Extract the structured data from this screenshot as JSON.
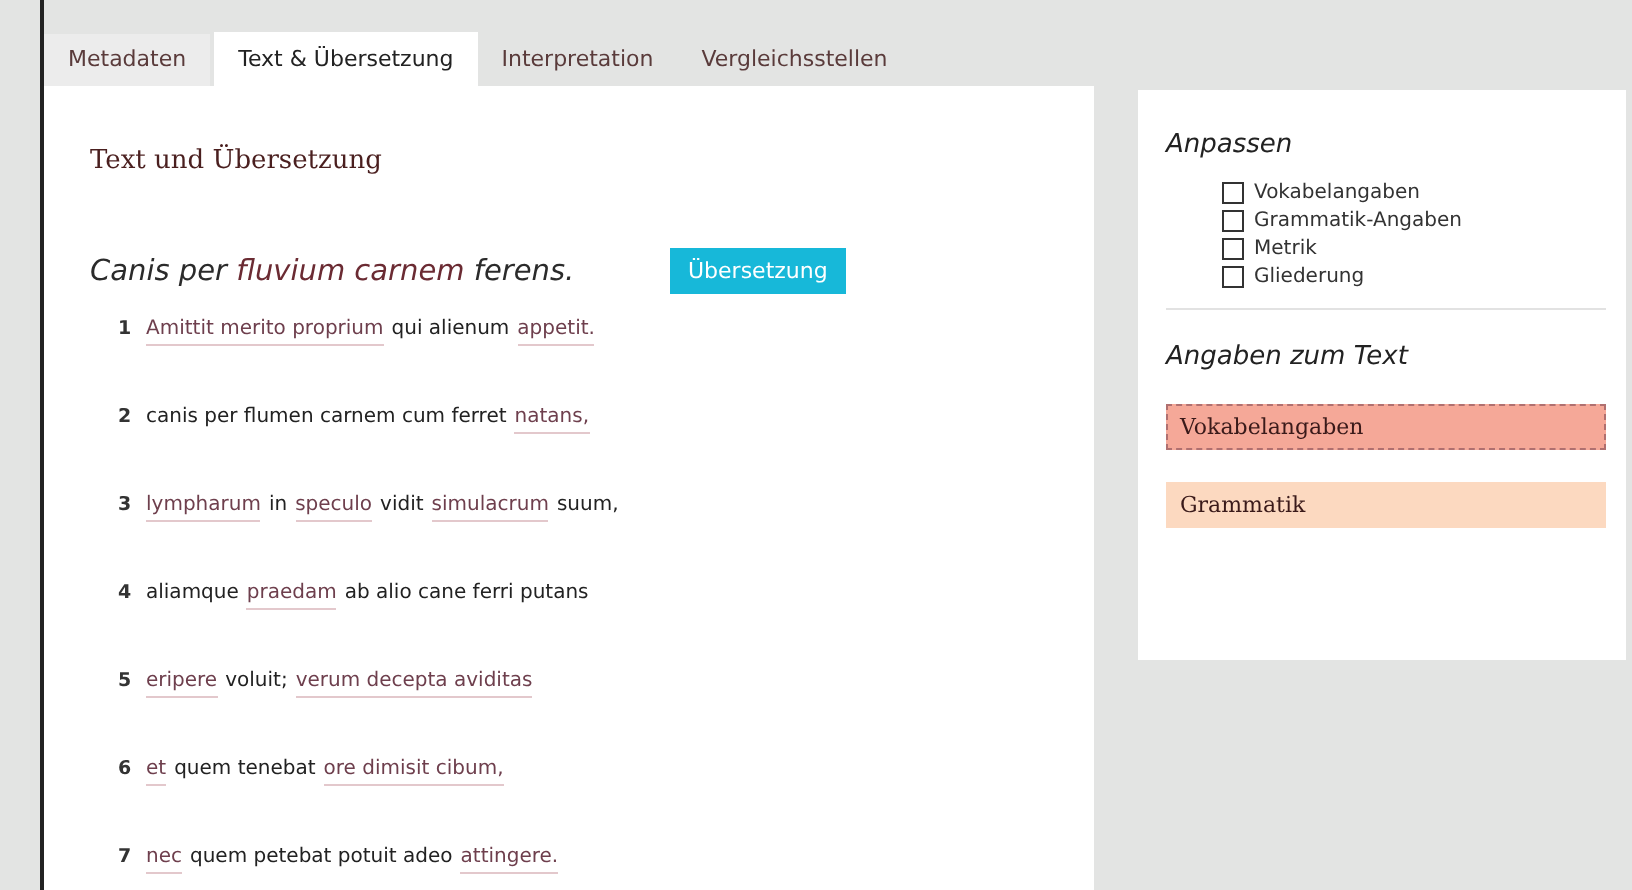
{
  "tabs": [
    {
      "label": "Metadaten",
      "selected": false
    },
    {
      "label": "Text & Übersetzung",
      "selected": true
    },
    {
      "label": "Interpretation",
      "selected": false
    },
    {
      "label": "Vergleichsstellen",
      "selected": false
    }
  ],
  "main": {
    "heading": "Text und Übersetzung",
    "poem_title": [
      {
        "text": "Canis per ",
        "highlighted": false
      },
      {
        "text": "fluvium carnem",
        "highlighted": true
      },
      {
        "text": " ferens.",
        "highlighted": false
      }
    ],
    "translate_button": "Übersetzung",
    "lines": [
      {
        "number": "1",
        "segments": [
          {
            "text": "Amittit merito proprium",
            "annotated": true
          },
          {
            "text": "qui alienum",
            "annotated": false
          },
          {
            "text": "appetit.",
            "annotated": true
          }
        ]
      },
      {
        "number": "2",
        "segments": [
          {
            "text": "canis per flumen carnem cum ferret",
            "annotated": false
          },
          {
            "text": "natans,",
            "annotated": true
          }
        ]
      },
      {
        "number": "3",
        "segments": [
          {
            "text": "lympharum",
            "annotated": true
          },
          {
            "text": "in",
            "annotated": false
          },
          {
            "text": "speculo",
            "annotated": true
          },
          {
            "text": "vidit",
            "annotated": false
          },
          {
            "text": "simulacrum",
            "annotated": true
          },
          {
            "text": "suum,",
            "annotated": false
          }
        ]
      },
      {
        "number": "4",
        "segments": [
          {
            "text": "aliamque",
            "annotated": false
          },
          {
            "text": "praedam",
            "annotated": true
          },
          {
            "text": "ab alio cane ferri putans",
            "annotated": false
          }
        ]
      },
      {
        "number": "5",
        "segments": [
          {
            "text": "eripere",
            "annotated": true
          },
          {
            "text": "voluit;",
            "annotated": false
          },
          {
            "text": "verum decepta aviditas",
            "annotated": true
          }
        ]
      },
      {
        "number": "6",
        "segments": [
          {
            "text": "et",
            "annotated": true
          },
          {
            "text": "quem tenebat",
            "annotated": false
          },
          {
            "text": "ore dimisit cibum,",
            "annotated": true
          }
        ]
      },
      {
        "number": "7",
        "segments": [
          {
            "text": "nec",
            "annotated": true
          },
          {
            "text": "quem petebat potuit adeo",
            "annotated": false
          },
          {
            "text": "attingere.",
            "annotated": true
          }
        ]
      }
    ]
  },
  "sidebar": {
    "customize_title": "Anpassen",
    "options": [
      {
        "label": "Vokabelangaben",
        "checked": false
      },
      {
        "label": "Grammatik-Angaben",
        "checked": false
      },
      {
        "label": "Metrik",
        "checked": false
      },
      {
        "label": "Gliederung",
        "checked": false
      }
    ],
    "info_title": "Angaben zum Text",
    "info_items": [
      {
        "label": "Vokabelangaben",
        "color": "#f5a898",
        "selected": true
      },
      {
        "label": "Grammatik",
        "color": "#fcd9c0",
        "selected": false
      }
    ]
  }
}
